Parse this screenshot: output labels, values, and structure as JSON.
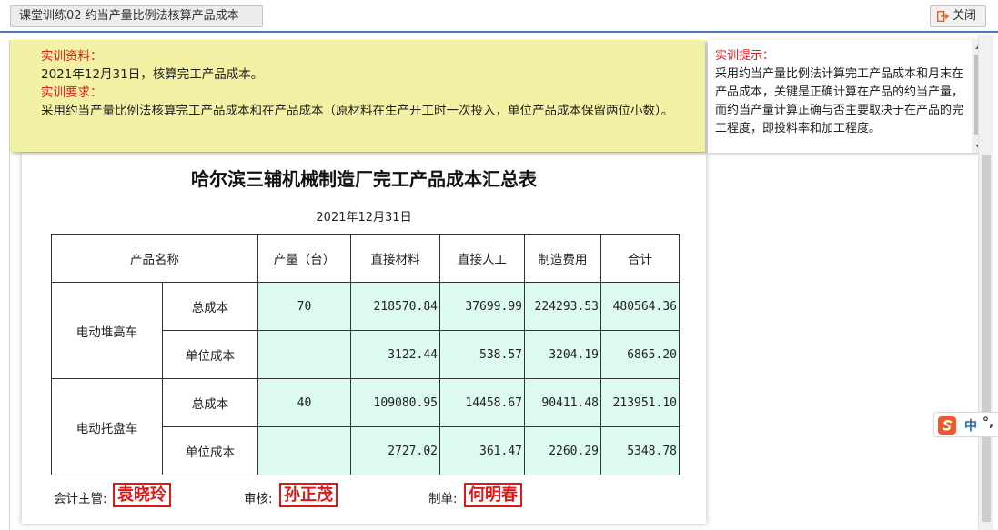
{
  "header": {
    "title": "课堂训练02 约当产量比例法核算产品成本",
    "close_label": "关闭"
  },
  "material": {
    "heading1": "实训资料：",
    "line1": "2021年12月31日，核算完工产品成本。",
    "heading2": "实训要求：",
    "line2": "采用约当产量比例法核算完工产品成本和在产品成本（原材料在生产开工时一次投入，单位产品成本保留两位小数）。"
  },
  "hint": {
    "heading": "实训提示：",
    "text": "采用约当产量比例法计算完工产品成本和月末在产品成本，关键是正确计算在产品的约当产量，而约当产量计算正确与否主要取决于在产品的完工程度，即投料率和加工程度。"
  },
  "report": {
    "title": "哈尔滨三辅机械制造厂完工产品成本汇总表",
    "date": "2021年12月31日",
    "columns": [
      "产品名称",
      "产量（台）",
      "直接材料",
      "直接人工",
      "制造费用",
      "合计"
    ],
    "products": [
      {
        "name": "电动堆高车",
        "rows": [
          {
            "label": "总成本",
            "qty": "70",
            "material": "218570.84",
            "labor": "37699.99",
            "overhead": "224293.53",
            "total": "480564.36"
          },
          {
            "label": "单位成本",
            "qty": "",
            "material": "3122.44",
            "labor": "538.57",
            "overhead": "3204.19",
            "total": "6865.20"
          }
        ]
      },
      {
        "name": "电动托盘车",
        "rows": [
          {
            "label": "总成本",
            "qty": "40",
            "material": "109080.95",
            "labor": "14458.67",
            "overhead": "90411.48",
            "total": "213951.10"
          },
          {
            "label": "单位成本",
            "qty": "",
            "material": "2727.02",
            "labor": "361.47",
            "overhead": "2260.29",
            "total": "5348.78"
          }
        ]
      }
    ],
    "signatures": {
      "supervisor_label": "会计主管:",
      "supervisor_stamp": "袁晓玲",
      "reviewer_label": "审核:",
      "reviewer_stamp": "孙正茂",
      "preparer_label": "制单:",
      "preparer_stamp": "何明春"
    }
  },
  "ime": {
    "mode_label": "中",
    "punct_label": "°,"
  },
  "colors": {
    "accent": "#4a78b8",
    "material_bg": "#f3f1a4",
    "input_cell_bg": "#dcfaef",
    "stamp_red": "#e01818",
    "heading_red": "#e02020"
  }
}
